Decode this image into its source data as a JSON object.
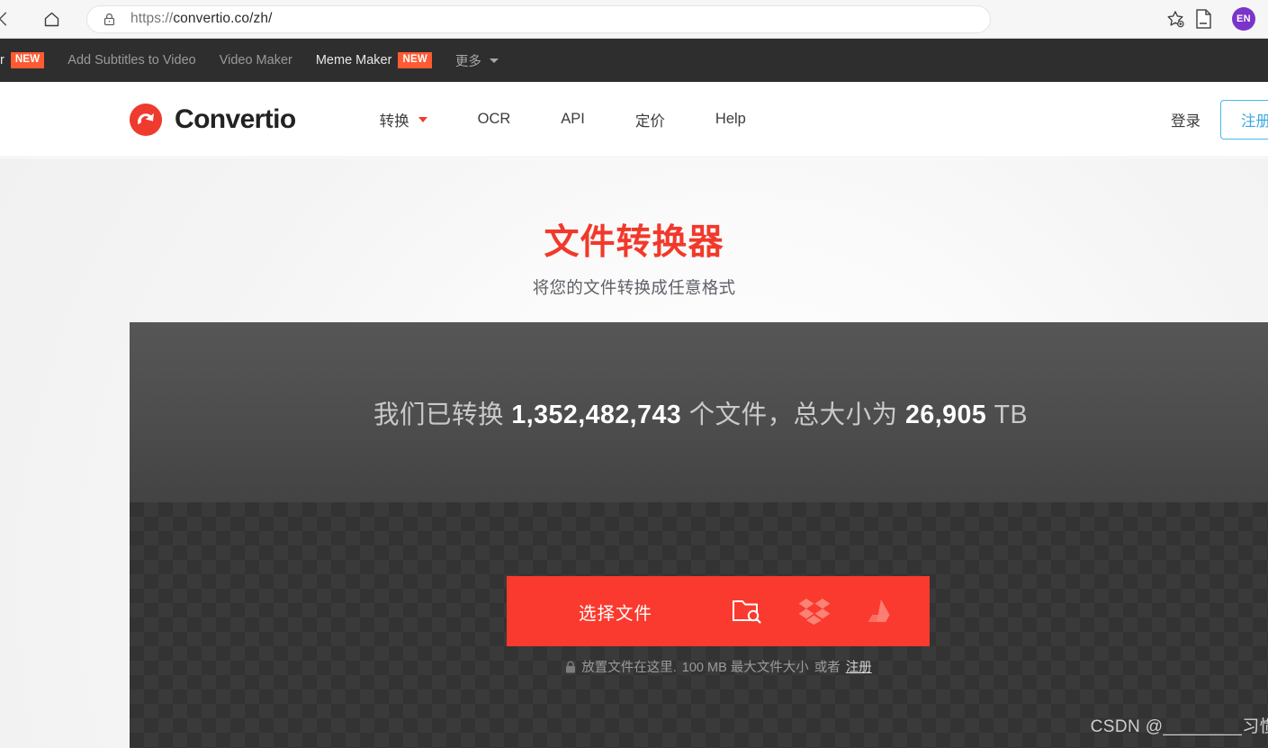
{
  "browser": {
    "url_scheme": "https://",
    "url_rest": "convertio.co/zh/",
    "url_full": "https://convertio.co/zh/",
    "icons": {
      "back": "back-arrow-icon",
      "home": "home-icon",
      "lock": "lock-icon",
      "bookmark": "star-add-icon",
      "reader": "document-icon"
    },
    "profile_initials": "EN",
    "profile_color": "#7b34c9"
  },
  "promo_nav": {
    "items": [
      {
        "label": "r",
        "badge": "NEW",
        "bright": true,
        "clipped": true
      },
      {
        "label": "Add Subtitles to Video",
        "badge": "",
        "bright": false
      },
      {
        "label": "Video Maker",
        "badge": "",
        "bright": false
      },
      {
        "label": "Meme Maker",
        "badge": "NEW",
        "bright": true
      }
    ],
    "more_label": "更多"
  },
  "header": {
    "brand": "Convertio",
    "brand_color": "#ee3b2e",
    "nav": [
      {
        "label": "转换",
        "has_caret": true
      },
      {
        "label": "OCR",
        "has_caret": false
      },
      {
        "label": "API",
        "has_caret": false
      },
      {
        "label": "定价",
        "has_caret": false
      },
      {
        "label": "Help",
        "has_caret": false
      }
    ],
    "login_label": "登录",
    "signup_label": "注册",
    "signup_color": "#3aa7e2"
  },
  "hero": {
    "title": "文件转换器",
    "subtitle": "将您的文件转换成任意格式",
    "title_color": "#f1392b"
  },
  "stats": {
    "prefix": "我们已转换",
    "files_count": "1,352,482,743",
    "middle": "个文件，总大小为",
    "total_size": "26,905",
    "suffix": "TB"
  },
  "dropzone": {
    "choose_button_label": "选择文件",
    "accent_color": "#fa3a2e",
    "sources": [
      {
        "name": "folder-search-icon"
      },
      {
        "name": "dropbox-icon"
      },
      {
        "name": "google-drive-icon"
      }
    ],
    "hint_prefix": "放置文件在这里.",
    "hint_limit": "100 MB 最大文件大小",
    "hint_or": "或者",
    "hint_signup": "注册"
  },
  "watermark": {
    "text": "CSDN @________习惯"
  }
}
